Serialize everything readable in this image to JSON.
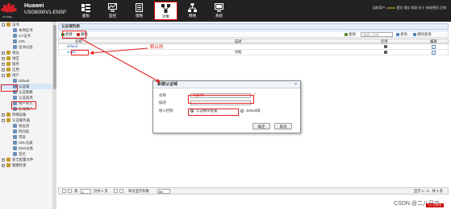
{
  "header": {
    "logo_text": "HUAWEI",
    "brand_name": "Huawei",
    "model": "USG6000V1-ENSP",
    "nav": [
      {
        "label": "面板",
        "icon": "dashboard-icon"
      },
      {
        "label": "监控",
        "icon": "monitor-icon"
      },
      {
        "label": "策略",
        "icon": "policy-icon"
      },
      {
        "label": "对象",
        "icon": "object-icon",
        "active": true
      },
      {
        "label": "网络",
        "icon": "network-icon"
      },
      {
        "label": "系统",
        "icon": "system-icon"
      }
    ],
    "user_prefix": "当前用户:",
    "user": "admin",
    "links": [
      "提交",
      "保存",
      "帮助",
      "关于",
      "修改密码",
      "注销"
    ]
  },
  "sidebar": {
    "items": [
      {
        "label": "证书",
        "level": 0,
        "toggle": "-",
        "color": "#c59a2b"
      },
      {
        "label": "本地证书",
        "level": 1,
        "color": "#6d8fb8"
      },
      {
        "label": "CA证书",
        "level": 1,
        "color": "#6d8fb8"
      },
      {
        "label": "CRL",
        "level": 1,
        "color": "#6d8fb8"
      },
      {
        "label": "证书过滤",
        "level": 1,
        "color": "#6d8fb8"
      },
      {
        "label": "地址",
        "level": 0,
        "toggle": "+",
        "color": "#c59a2b"
      },
      {
        "label": "地区",
        "level": 0,
        "toggle": "+",
        "color": "#c59a2b"
      },
      {
        "label": "服务",
        "level": 0,
        "toggle": "+",
        "color": "#c59a2b"
      },
      {
        "label": "应用",
        "level": 0,
        "toggle": "+",
        "color": "#c59a2b"
      },
      {
        "label": "用户",
        "level": 0,
        "toggle": "-",
        "color": "#c59a2b",
        "highlight": true
      },
      {
        "label": "default",
        "level": 1,
        "color": "#6d8fb8"
      },
      {
        "label": "认证域",
        "level": 1,
        "color": "#6d8fb8",
        "highlight": true,
        "selected": true
      },
      {
        "label": "认证策略",
        "level": 1,
        "color": "#6d8fb8"
      },
      {
        "label": "认证选项",
        "level": 1,
        "color": "#6d8fb8"
      },
      {
        "label": "用户导入",
        "level": 1,
        "color": "#6d8fb8"
      },
      {
        "label": "在线用户",
        "level": 1,
        "color": "#6d8fb8"
      },
      {
        "label": "终端设备",
        "level": 0,
        "toggle": "+",
        "color": "#c59a2b"
      },
      {
        "label": "认证服务器",
        "level": 0,
        "toggle": "+",
        "color": "#c59a2b"
      },
      {
        "label": "地址池",
        "level": 1,
        "color": "#6d8fb8"
      },
      {
        "label": "时间段",
        "level": 1,
        "color": "#6d8fb8"
      },
      {
        "label": "带宽",
        "level": 1,
        "color": "#6d8fb8"
      },
      {
        "label": "URL分类",
        "level": 1,
        "color": "#6d8fb8"
      },
      {
        "label": "DNS分类",
        "level": 1,
        "color": "#6d8fb8"
      },
      {
        "label": "签名",
        "level": 1,
        "color": "#6d8fb8"
      },
      {
        "label": "安全配置文件",
        "level": 0,
        "toggle": "+",
        "color": "#c59a2b"
      },
      {
        "label": "健康检查",
        "level": 0,
        "toggle": "+",
        "color": "#c59a2b"
      }
    ]
  },
  "panel": {
    "title": "认证域列表",
    "toolbar": {
      "new_label": "新建",
      "delete_label": "删除",
      "query_label": "查询",
      "search_placeholder": "请输入名称",
      "search_btn": "查询",
      "clear_btn": "清除查询"
    },
    "columns": [
      "名称",
      "描述",
      "启用",
      "编辑"
    ],
    "rows": [
      {
        "name": "default",
        "desc": "",
        "enabled": true
      },
      {
        "name": "ouper",
        "desc": "抗能",
        "enabled": true
      }
    ],
    "annotation": "默认的"
  },
  "pager": {
    "page_label": "第",
    "page_value": "1",
    "page_total": "页共 1 页",
    "per_page_label": "每页显示条数",
    "per_page_value": "50",
    "summary": "显示 1 - 2，共 2 条"
  },
  "dialog": {
    "title": "新建认证域",
    "close": "×",
    "name_label": "名称",
    "name_value": "oupen",
    "required_mark": "*",
    "desc_label": "描述",
    "desc_value": "",
    "access_label": "接入控制",
    "option1": "认证模块配置",
    "option2": "default域",
    "ok": "确定",
    "cancel": "取消"
  },
  "footer": {
    "watermark": "CSDN @二八只刃",
    "cli": "CLI 控制台"
  }
}
